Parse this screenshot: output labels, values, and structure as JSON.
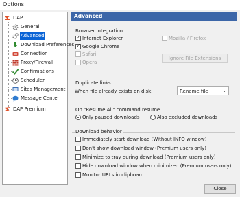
{
  "window": {
    "title": "Options"
  },
  "tree": {
    "root": "DAP",
    "items": [
      {
        "label": "General"
      },
      {
        "label": "Advanced"
      },
      {
        "label": "Download Preferences"
      },
      {
        "label": "Connection"
      },
      {
        "label": "Proxy/Firewall"
      },
      {
        "label": "Confirmations"
      },
      {
        "label": "Scheduler"
      },
      {
        "label": "Sites Management"
      },
      {
        "label": "Message Center"
      }
    ],
    "premium": "DAP Premium",
    "selected": "Advanced"
  },
  "header": {
    "title": "Advanced"
  },
  "browser_integration": {
    "title": "Browser integration",
    "items": [
      {
        "label": "Internet Explorer",
        "checked": true,
        "enabled": true
      },
      {
        "label": "Google Chrome",
        "checked": true,
        "enabled": true
      },
      {
        "label": "Safari",
        "checked": false,
        "enabled": false
      },
      {
        "label": "Opera",
        "checked": false,
        "enabled": false
      },
      {
        "label": "Mozilla / Firefox",
        "checked": false,
        "enabled": false
      }
    ],
    "ignore_button": "Ignore File Extensions"
  },
  "duplicate_links": {
    "title": "Duplicate links",
    "prompt": "When file already exists on disk:",
    "selected_option": "Rename file"
  },
  "resume_all": {
    "title": "On \"Resume All\" command resume....",
    "options": [
      {
        "label": "Only paused downloads",
        "selected": true
      },
      {
        "label": "Also excluded downloads",
        "selected": false
      }
    ]
  },
  "download_behavior": {
    "title": "Download behavior",
    "items": [
      {
        "label": "Immediately start download (Without INFO window)",
        "checked": false
      },
      {
        "label": "Don't show download window (Premium users only)",
        "checked": false
      },
      {
        "label": "Minimize to tray during download (Premium users only)",
        "checked": false
      },
      {
        "label": "Hide download window when minimized (Premium users only)",
        "checked": false
      },
      {
        "label": "Monitor URLs in clipboard",
        "checked": false
      }
    ]
  },
  "footer": {
    "close_label": "Close"
  },
  "colors": {
    "header_bg": "#3c66a8",
    "selection": "#0a64d6"
  }
}
